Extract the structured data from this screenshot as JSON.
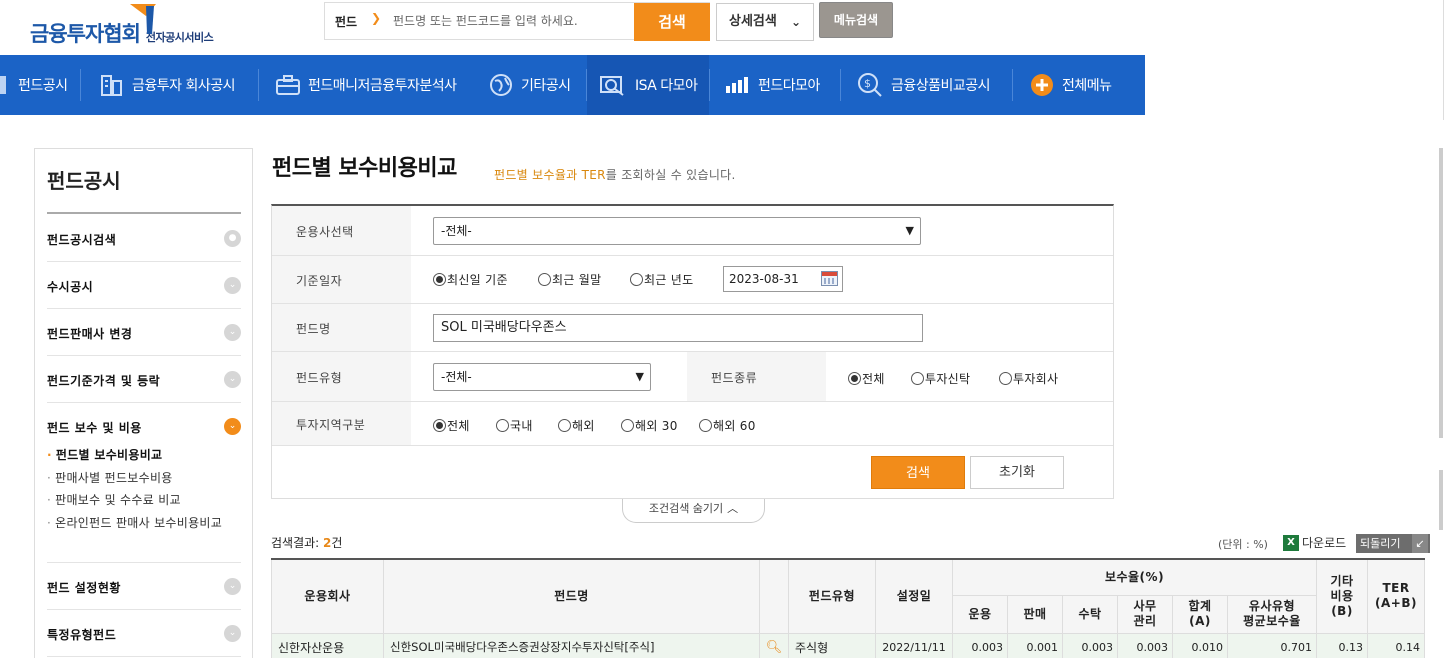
{
  "header": {
    "logo_main": "금융투자협회",
    "logo_sub": "전자공시서비스",
    "search_type": "펀드",
    "search_placeholder": "펀드명 또는 펀드코드를 입력 하세요.",
    "search_button": "검색",
    "detail_search_button": "상세검색",
    "menu_search_button": "메뉴검색"
  },
  "nav": {
    "items": [
      {
        "label": "펀드공시",
        "icon": "fund-disclosure-icon"
      },
      {
        "label": "금융투자 회사공시",
        "icon": "building-icon"
      },
      {
        "label": "펀드매니저금융투자분석사",
        "icon": "briefcase-icon"
      },
      {
        "label": "기타공시",
        "icon": "globe-icon"
      },
      {
        "label": "ISA 다모아",
        "icon": "magnifier-chart-icon"
      },
      {
        "label": "펀드다모아",
        "icon": "bar-chart-icon"
      },
      {
        "label": "금융상품비교공시",
        "icon": "coin-search-icon"
      },
      {
        "label": "전체메뉴",
        "icon": "plus-circle-icon"
      }
    ]
  },
  "sidebar": {
    "title": "펀드공시",
    "items": [
      {
        "label": "펀드공시검색"
      },
      {
        "label": "수시공시"
      },
      {
        "label": "펀드판매사 변경"
      },
      {
        "label": "펀드기준가격 및 등락"
      },
      {
        "label": "펀드 보수 및 비용"
      },
      {
        "label": "펀드 설정현황"
      },
      {
        "label": "특정유형펀드"
      }
    ],
    "sub_items": [
      {
        "label": "펀드별 보수비용비교"
      },
      {
        "label": "판매사별 펀드보수비용"
      },
      {
        "label": "판매보수 및 수수료 비교"
      },
      {
        "label": "온라인펀드 판매사 보수비용비교"
      }
    ]
  },
  "page": {
    "title": "펀드별 보수비용비교",
    "subtitle_highlight": "펀드별 보수율과 TER",
    "subtitle_rest": "를 조회하실 수 있습니다."
  },
  "form": {
    "manager_label": "운용사선택",
    "manager_value": "-전체-",
    "date_label": "기준일자",
    "date_options": [
      "최신일 기준",
      "최근 월말",
      "최근 년도"
    ],
    "date_value": "2023-08-31",
    "fund_name_label": "펀드명",
    "fund_name_value": "SOL 미국배당다우존스",
    "fund_type_label": "펀드유형",
    "fund_type_value": "-전체-",
    "fund_kind_label": "펀드종류",
    "fund_kind_options": [
      "전체",
      "투자신탁",
      "투자회사"
    ],
    "region_label": "투자지역구분",
    "region_options": [
      "전체",
      "국내",
      "해외",
      "해외 30",
      "해외 60"
    ],
    "search_button": "검색",
    "reset_button": "초기화",
    "toggle_label": "조건검색 숨기기"
  },
  "results": {
    "count_label": "검색결과:",
    "count": "2",
    "count_unit": "건",
    "unit_label": "(단위 : %)",
    "download_label": "다운로드",
    "back_label": "되돌리기"
  },
  "table": {
    "headers": {
      "manager": "운용회사",
      "fund_name": "펀드명",
      "fund_type": "펀드유형",
      "established": "설정일",
      "fee_group": "보수율(%)",
      "other_cost_line1": "기타",
      "other_cost_line2": "비용",
      "other_cost_line3": "(B)",
      "ter_line1": "TER",
      "ter_line2": "(A+B)",
      "fee_mgmt": "운용",
      "fee_sales": "판매",
      "fee_trust": "수탁",
      "fee_admin_line1": "사무",
      "fee_admin_line2": "관리",
      "fee_total_line1": "합계",
      "fee_total_line2": "(A)",
      "fee_similar_line1": "유사유형",
      "fee_similar_line2": "평균보수율"
    },
    "rows": [
      {
        "manager": "신한자산운용",
        "fund_name": "신한SOL미국배당다우존스증권상장지수투자신탁[주식]",
        "fund_type": "주식형",
        "established": "2022/11/11",
        "fee_mgmt": "0.003",
        "fee_sales": "0.001",
        "fee_trust": "0.003",
        "fee_admin": "0.003",
        "fee_total": "0.010",
        "fee_similar": "0.701",
        "other_cost": "0.13",
        "ter": "0.14"
      }
    ]
  },
  "colors": {
    "brand_blue": "#1b63c6",
    "accent_orange": "#f28c1a"
  }
}
